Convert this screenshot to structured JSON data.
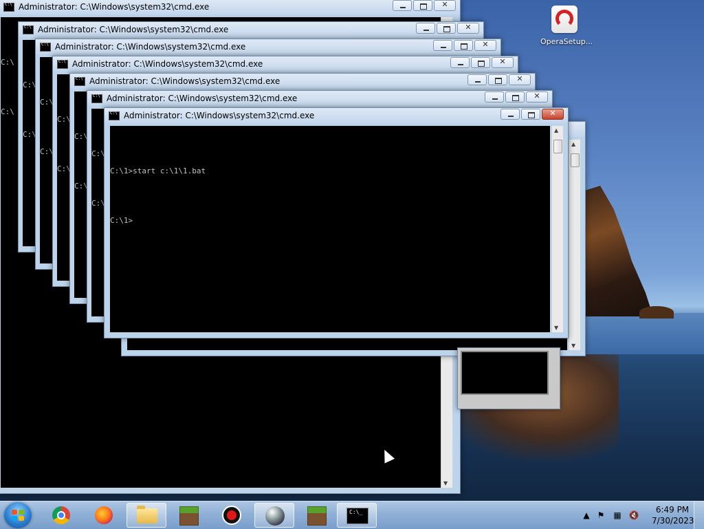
{
  "window_title": "Administrator: C:\\Windows\\system32\\cmd.exe",
  "console": {
    "line1": "C:\\1>start c:\\1\\1.bat",
    "line2": "C:\\1>",
    "bg_prompt": "C:\\",
    "bg_prompt2": "C:\\"
  },
  "desktop": {
    "opera_icon_label": "OperaSetup..."
  },
  "taskbar": {
    "items": [
      "start-button",
      "chrome",
      "firefox",
      "file-explorer",
      "minecraft",
      "recorder",
      "ball-app",
      "minecraft-2",
      "cmd"
    ],
    "active_item": "cmd",
    "time": "6:49 PM",
    "date": "7/30/2023"
  },
  "colors": {
    "console_bg": "#000000",
    "console_fg": "#c0c0c0",
    "titlebar": "#c3d6ec",
    "taskbar": "#8fb0d6",
    "close_active": "#c6432c"
  }
}
